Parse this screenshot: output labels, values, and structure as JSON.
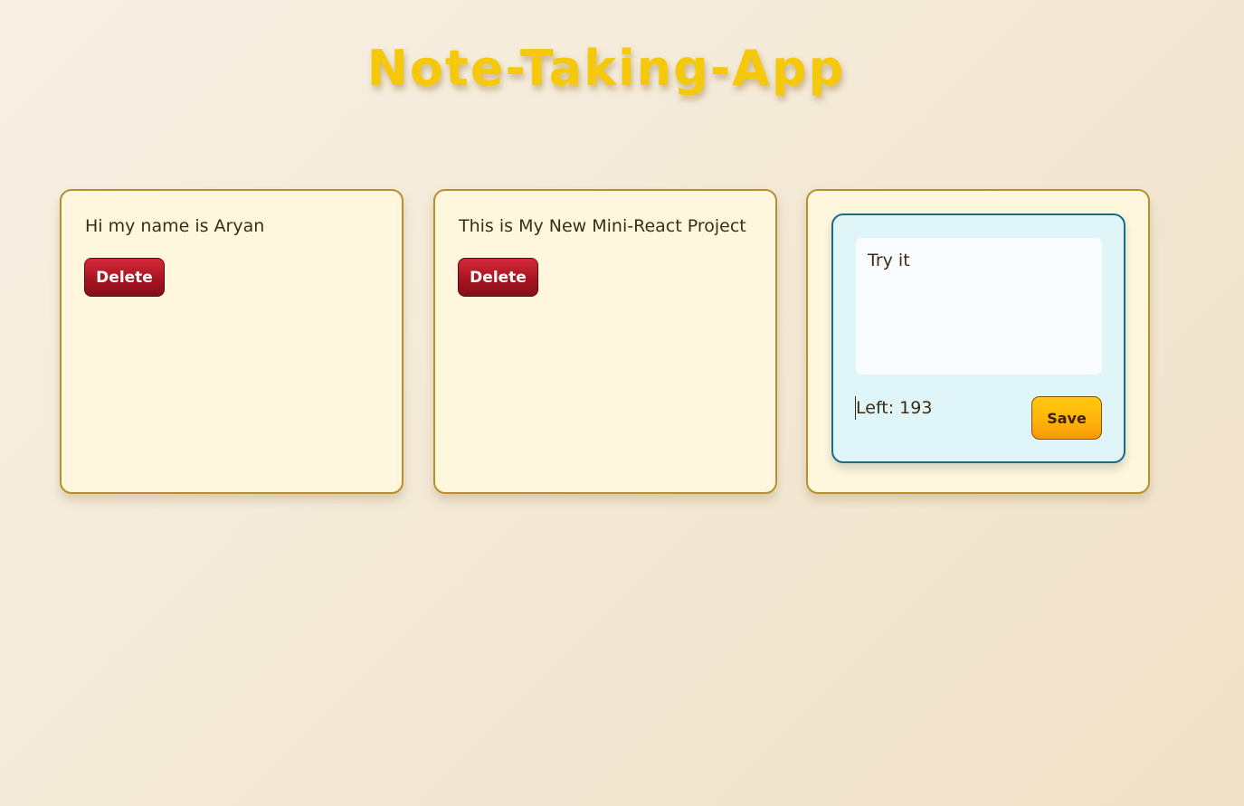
{
  "app": {
    "title": "Note-Taking-App"
  },
  "notes": [
    {
      "text": "Hi my name is Aryan",
      "delete_label": "Delete"
    },
    {
      "text": "This is My New Mini-React Project",
      "delete_label": "Delete"
    }
  ],
  "editor": {
    "value": "Try it",
    "chars_left_label": "Left: 193",
    "save_label": "Save"
  },
  "colors": {
    "title": "#f5c80a",
    "note_background": "#fff7dd",
    "note_border": "#b8902a",
    "delete_button": "#a3121f",
    "save_button": "#ffb40a",
    "editor_background": "#dff5f8",
    "editor_border": "#1c6a8a"
  }
}
